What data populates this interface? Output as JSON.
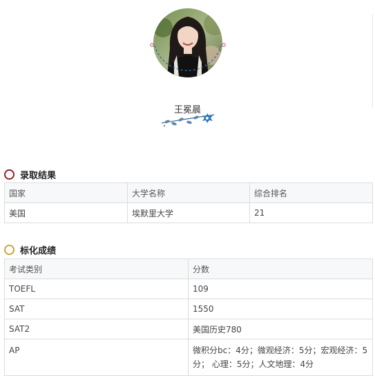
{
  "profile": {
    "name": "王冕晨",
    "avatar_alt": "student-photo"
  },
  "admission": {
    "title": "录取结果",
    "headers": [
      "国家",
      "大学名称",
      "综合排名"
    ],
    "rows": [
      [
        "美国",
        "埃默里大学",
        "21"
      ]
    ]
  },
  "scores": {
    "title": "标化成绩",
    "headers": [
      "考试类别",
      "分数"
    ],
    "rows": [
      [
        "TOEFL",
        "109"
      ],
      [
        "SAT",
        "1550"
      ],
      [
        "SAT2",
        "美国历史780"
      ],
      [
        "AP",
        "微积分bc：4分；微观经济：5分；宏观经济：5分； 心理：5分；人文地理：4分"
      ]
    ]
  },
  "colors": {
    "ring_red": "#9b1c24",
    "ring_gold": "#c9a43a",
    "border": "#dcdcdc",
    "header_bg": "#f7f8fa"
  }
}
